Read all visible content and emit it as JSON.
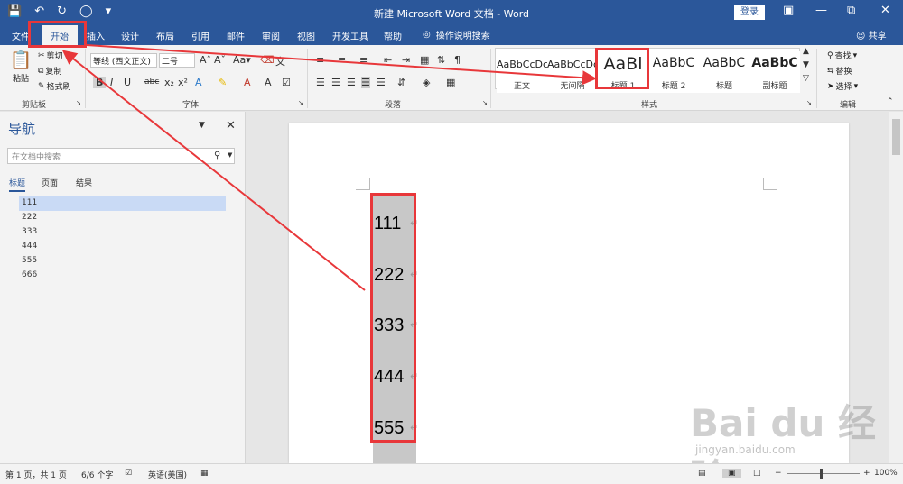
{
  "window": {
    "title": "新建 Microsoft Word 文档 - Word",
    "login_label": "登录",
    "accent": "#2b579a"
  },
  "tabs": [
    {
      "label": "文件"
    },
    {
      "label": "开始"
    },
    {
      "label": "插入"
    },
    {
      "label": "设计"
    },
    {
      "label": "布局"
    },
    {
      "label": "引用"
    },
    {
      "label": "邮件"
    },
    {
      "label": "审阅"
    },
    {
      "label": "视图"
    },
    {
      "label": "开发工具"
    },
    {
      "label": "帮助"
    }
  ],
  "tell_me": "操作说明搜索",
  "share": "共享",
  "ribbon": {
    "clipboard": {
      "paste": "粘贴",
      "cut": "剪切",
      "copy": "复制",
      "format_painter": "格式刷",
      "label": "剪贴板"
    },
    "font": {
      "font_name": "等线 (西文正文)",
      "font_size": "二号",
      "label": "字体"
    },
    "paragraph": {
      "label": "段落"
    },
    "styles": {
      "label": "样式",
      "items": [
        {
          "sample": "AaBbCcDc",
          "name": "正文"
        },
        {
          "sample": "AaBbCcDc",
          "name": "无间隔"
        },
        {
          "sample": "AaBl",
          "name": "标题 1"
        },
        {
          "sample": "AaBbC",
          "name": "标题 2"
        },
        {
          "sample": "AaBbC",
          "name": "标题"
        },
        {
          "sample": "AaBbC",
          "name": "副标题"
        }
      ]
    },
    "editing": {
      "find": "查找",
      "replace": "替换",
      "select": "选择",
      "label": "编辑"
    }
  },
  "nav": {
    "title": "导航",
    "search_placeholder": "在文档中搜索",
    "tabs": [
      "标题",
      "页面",
      "结果"
    ],
    "items": [
      "111",
      "222",
      "333",
      "444",
      "555",
      "666"
    ]
  },
  "document": {
    "headings": [
      "111",
      "222",
      "333",
      "444",
      "555"
    ]
  },
  "status": {
    "page": "第 1 页，共 1 页",
    "words": "6/6 个字",
    "language": "英语(美国)",
    "zoom": "100%"
  },
  "annotation_color": "#e8373a",
  "watermark": {
    "text": "Bai du 经验",
    "url": "jingyan.baidu.com"
  }
}
